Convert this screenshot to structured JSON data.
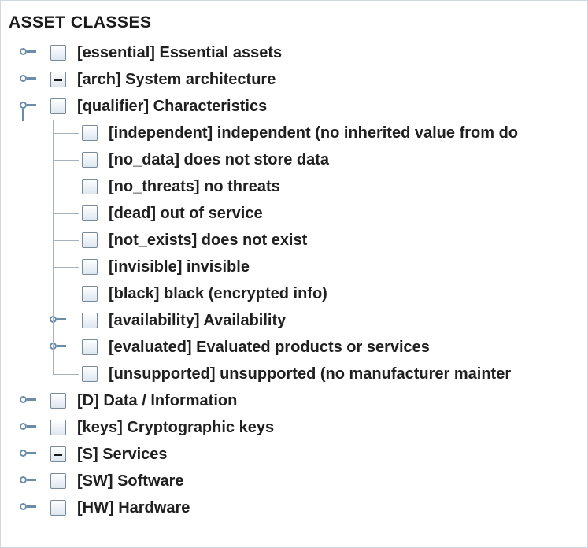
{
  "tree": {
    "title": "ASSET CLASSES",
    "nodes": [
      {
        "label": "[essential] Essential assets",
        "state": "unchecked",
        "handle": "collapsed"
      },
      {
        "label": "[arch] System architecture",
        "state": "partial",
        "handle": "collapsed"
      },
      {
        "label": "[qualifier] Characteristics",
        "state": "unchecked",
        "handle": "expanded",
        "children": [
          {
            "label": "[independent] independent (no inherited value from do",
            "state": "unchecked",
            "handle": "leaf"
          },
          {
            "label": "[no_data] does not store data",
            "state": "unchecked",
            "handle": "leaf"
          },
          {
            "label": "[no_threats] no threats",
            "state": "unchecked",
            "handle": "leaf"
          },
          {
            "label": "[dead] out of service",
            "state": "unchecked",
            "handle": "leaf"
          },
          {
            "label": "[not_exists] does not exist",
            "state": "unchecked",
            "handle": "leaf"
          },
          {
            "label": "[invisible] invisible",
            "state": "unchecked",
            "handle": "leaf"
          },
          {
            "label": "[black] black (encrypted info)",
            "state": "unchecked",
            "handle": "leaf"
          },
          {
            "label": "[availability] Availability",
            "state": "unchecked",
            "handle": "collapsed"
          },
          {
            "label": "[evaluated] Evaluated products or services",
            "state": "unchecked",
            "handle": "collapsed"
          },
          {
            "label": "[unsupported] unsupported (no manufacturer mainter",
            "state": "unchecked",
            "handle": "leaf"
          }
        ]
      },
      {
        "label": "[D] Data / Information",
        "state": "unchecked",
        "handle": "collapsed"
      },
      {
        "label": "[keys] Cryptographic keys",
        "state": "unchecked",
        "handle": "collapsed"
      },
      {
        "label": "[S] Services",
        "state": "partial",
        "handle": "collapsed"
      },
      {
        "label": "[SW] Software",
        "state": "unchecked",
        "handle": "collapsed"
      },
      {
        "label": "[HW] Hardware",
        "state": "unchecked",
        "handle": "collapsed"
      }
    ]
  },
  "colors": {
    "handle": "#6b8ba8",
    "connector": "#a8b2bc",
    "checkbox_border": "#7a8a9a"
  }
}
